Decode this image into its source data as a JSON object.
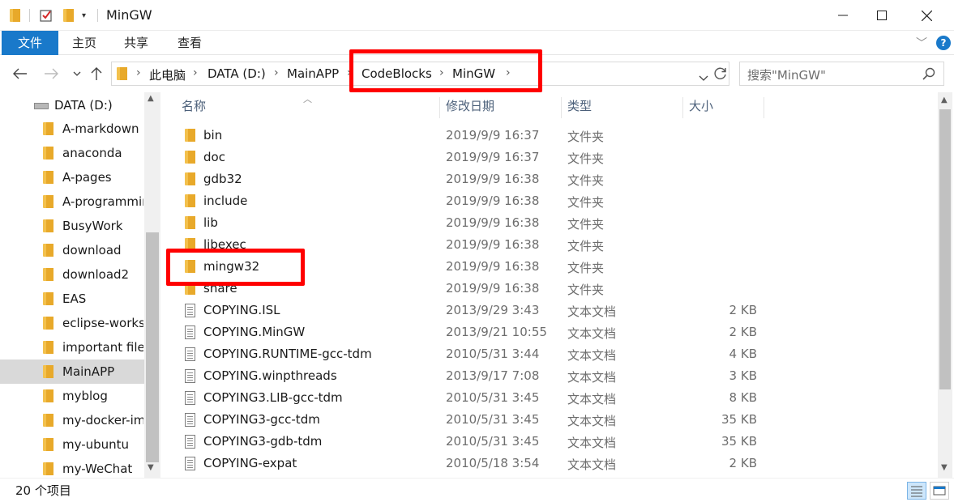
{
  "window": {
    "title": "MinGW"
  },
  "ribbon": {
    "tabs": [
      {
        "label": "文件"
      },
      {
        "label": "主页"
      },
      {
        "label": "共享"
      },
      {
        "label": "查看"
      }
    ]
  },
  "address": {
    "crumbs": [
      "此电脑",
      "DATA (D:)",
      "MainAPP",
      "CodeBlocks",
      "MinGW"
    ]
  },
  "search": {
    "placeholder": "搜索\"MinGW\""
  },
  "sidebar": {
    "drive": "DATA (D:)",
    "items": [
      {
        "label": "A-markdown"
      },
      {
        "label": "anaconda"
      },
      {
        "label": "A-pages"
      },
      {
        "label": "A-programming"
      },
      {
        "label": "BusyWork"
      },
      {
        "label": "download"
      },
      {
        "label": "download2"
      },
      {
        "label": "EAS"
      },
      {
        "label": "eclipse-workspace"
      },
      {
        "label": "important files"
      },
      {
        "label": "MainAPP",
        "selected": true
      },
      {
        "label": "myblog"
      },
      {
        "label": "my-docker-images"
      },
      {
        "label": "my-ubuntu"
      },
      {
        "label": "my-WeChat"
      }
    ]
  },
  "columns": {
    "name": "名称",
    "date": "修改日期",
    "type": "类型",
    "size": "大小"
  },
  "files": [
    {
      "name": "bin",
      "date": "2019/9/9 16:37",
      "type": "文件夹",
      "size": "",
      "icon": "folder-icon"
    },
    {
      "name": "doc",
      "date": "2019/9/9 16:37",
      "type": "文件夹",
      "size": "",
      "icon": "folder-icon"
    },
    {
      "name": "gdb32",
      "date": "2019/9/9 16:38",
      "type": "文件夹",
      "size": "",
      "icon": "folder-icon"
    },
    {
      "name": "include",
      "date": "2019/9/9 16:38",
      "type": "文件夹",
      "size": "",
      "icon": "folder-icon"
    },
    {
      "name": "lib",
      "date": "2019/9/9 16:38",
      "type": "文件夹",
      "size": "",
      "icon": "folder-icon"
    },
    {
      "name": "libexec",
      "date": "2019/9/9 16:38",
      "type": "文件夹",
      "size": "",
      "icon": "folder-icon"
    },
    {
      "name": "mingw32",
      "date": "2019/9/9 16:38",
      "type": "文件夹",
      "size": "",
      "icon": "folder-icon"
    },
    {
      "name": "share",
      "date": "2019/9/9 16:38",
      "type": "文件夹",
      "size": "",
      "icon": "folder-icon"
    },
    {
      "name": "COPYING.ISL",
      "date": "2013/9/29 3:43",
      "type": "文本文档",
      "size": "2 KB",
      "icon": "document-icon"
    },
    {
      "name": "COPYING.MinGW",
      "date": "2013/9/21 10:55",
      "type": "文本文档",
      "size": "2 KB",
      "icon": "document-icon"
    },
    {
      "name": "COPYING.RUNTIME-gcc-tdm",
      "date": "2010/5/31 3:44",
      "type": "文本文档",
      "size": "4 KB",
      "icon": "document-icon"
    },
    {
      "name": "COPYING.winpthreads",
      "date": "2013/9/17 7:08",
      "type": "文本文档",
      "size": "3 KB",
      "icon": "document-icon"
    },
    {
      "name": "COPYING3.LIB-gcc-tdm",
      "date": "2010/5/31 3:45",
      "type": "文本文档",
      "size": "8 KB",
      "icon": "document-icon"
    },
    {
      "name": "COPYING3-gcc-tdm",
      "date": "2010/5/31 3:45",
      "type": "文本文档",
      "size": "35 KB",
      "icon": "document-icon"
    },
    {
      "name": "COPYING3-gdb-tdm",
      "date": "2010/5/31 3:45",
      "type": "文本文档",
      "size": "35 KB",
      "icon": "document-icon"
    },
    {
      "name": "COPYING-expat",
      "date": "2010/5/18 3:54",
      "type": "文本文档",
      "size": "2 KB",
      "icon": "document-icon"
    }
  ],
  "status": {
    "count": "20 个项目"
  },
  "colors": {
    "accent": "#1979ca",
    "highlight": "#ff0000",
    "folder": "#f3c14d",
    "selected": "#d9d9d9"
  }
}
